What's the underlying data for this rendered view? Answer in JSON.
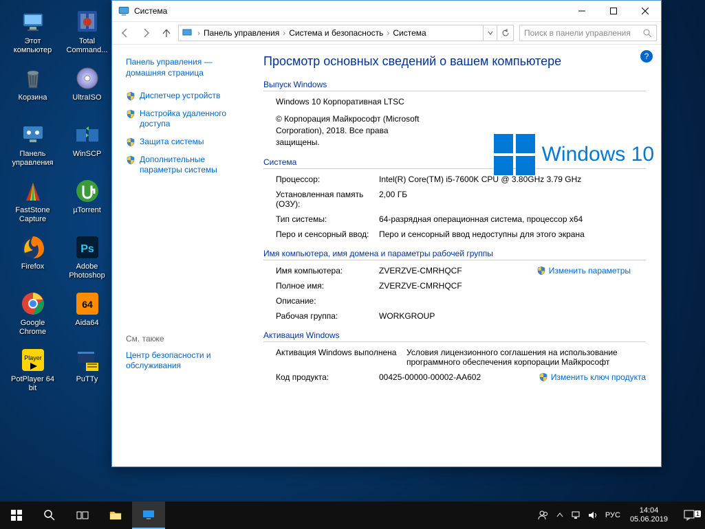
{
  "desktop_icons": [
    {
      "label": "Этот компьютер",
      "key": "this-pc"
    },
    {
      "label": "Total Command...",
      "key": "total-commander"
    },
    {
      "label": "Корзина",
      "key": "recycle-bin"
    },
    {
      "label": "UltraISO",
      "key": "ultraiso"
    },
    {
      "label": "Панель управления",
      "key": "control-panel"
    },
    {
      "label": "WinSCP",
      "key": "winscp"
    },
    {
      "label": "FastStone Capture",
      "key": "faststone"
    },
    {
      "label": "µTorrent",
      "key": "utorrent"
    },
    {
      "label": "Firefox",
      "key": "firefox"
    },
    {
      "label": "Adobe Photoshop",
      "key": "photoshop"
    },
    {
      "label": "Google Chrome",
      "key": "chrome"
    },
    {
      "label": "Aida64",
      "key": "aida64"
    },
    {
      "label": "PotPlayer 64 bit",
      "key": "potplayer"
    },
    {
      "label": "PuTTy",
      "key": "putty"
    }
  ],
  "window": {
    "title": "Система",
    "breadcrumb": [
      "Панель управления",
      "Система и безопасность",
      "Система"
    ],
    "search_placeholder": "Поиск в панели управления"
  },
  "sidebar": {
    "home": "Панель управления — домашняя страница",
    "items": [
      "Диспетчер устройств",
      "Настройка удаленного доступа",
      "Защита системы",
      "Дополнительные параметры системы"
    ],
    "see_also_h": "См. также",
    "see_also": "Центр безопасности и обслуживания"
  },
  "content": {
    "page_title": "Просмотр основных сведений о вашем компьютере",
    "edition_h": "Выпуск Windows",
    "edition": "Windows 10 Корпоративная LTSC",
    "copyright": "© Корпорация Майкрософт (Microsoft Corporation), 2018. Все права защищены.",
    "win_brand": "Windows 10",
    "system_h": "Система",
    "cpu_l": "Процессор:",
    "cpu_v": "Intel(R) Core(TM) i5-7600K CPU @ 3.80GHz   3.79 GHz",
    "ram_l": "Установленная память (ОЗУ):",
    "ram_v": "2,00 ГБ",
    "type_l": "Тип системы:",
    "type_v": "64-разрядная операционная система, процессор x64",
    "pen_l": "Перо и сенсорный ввод:",
    "pen_v": "Перо и сенсорный ввод недоступны для этого экрана",
    "name_h": "Имя компьютера, имя домена и параметры рабочей группы",
    "comp_l": "Имя компьютера:",
    "comp_v": "ZVERZVE-CMRHQCF",
    "full_l": "Полное имя:",
    "full_v": "ZVERZVE-CMRHQCF",
    "desc_l": "Описание:",
    "desc_v": "",
    "wg_l": "Рабочая группа:",
    "wg_v": "WORKGROUP",
    "change_settings": "Изменить параметры",
    "act_h": "Активация Windows",
    "act_status": "Активация Windows выполнена",
    "act_terms": "Условия лицензионного соглашения на использование программного обеспечения корпорации Майкрософт",
    "prod_l": "Код продукта:",
    "prod_v": "00425-00000-00002-AA602",
    "change_key": "Изменить ключ продукта"
  },
  "taskbar": {
    "lang": "РУС",
    "time": "14:04",
    "date": "05.06.2019"
  }
}
